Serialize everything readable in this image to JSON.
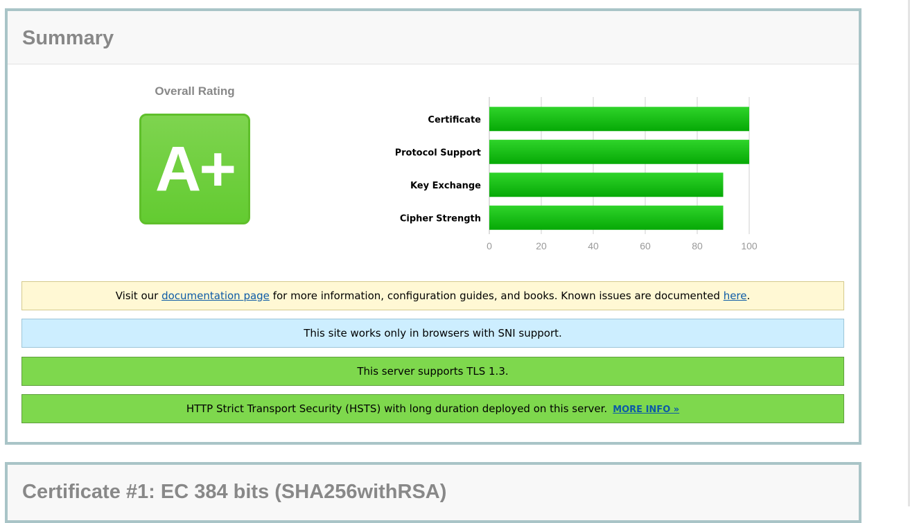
{
  "summary": {
    "title": "Summary",
    "overall_rating_label": "Overall Rating",
    "grade": "A+"
  },
  "chart_data": {
    "type": "bar",
    "orientation": "horizontal",
    "categories": [
      "Certificate",
      "Protocol Support",
      "Key Exchange",
      "Cipher Strength"
    ],
    "values": [
      100,
      100,
      90,
      90
    ],
    "xlim": [
      0,
      100
    ],
    "xticks": [
      0,
      20,
      40,
      60,
      80,
      100
    ],
    "grid": true,
    "title": "",
    "xlabel": "",
    "ylabel": "",
    "bar_color": "#16c013"
  },
  "banners": {
    "doc": {
      "prefix": "Visit our ",
      "link1": "documentation page",
      "middle": " for more information, configuration guides, and books. Known issues are documented ",
      "link2": "here",
      "suffix": "."
    },
    "sni": "This site works only in browsers with SNI support.",
    "tls": "This server supports TLS 1.3.",
    "hsts": "HTTP Strict Transport Security (HSTS) with long duration deployed on this server.",
    "hsts_link": "MORE INFO »"
  },
  "certificate": {
    "title": "Certificate #1: EC 384 bits (SHA256withRSA)"
  },
  "colors": {
    "grade_green": "#6ccd3b",
    "banner_green": "#7ed84d",
    "banner_yellow": "#fff8d4",
    "banner_blue": "#cdeeff",
    "panel_border": "#a9c4c7",
    "link": "#0c5aa6"
  }
}
